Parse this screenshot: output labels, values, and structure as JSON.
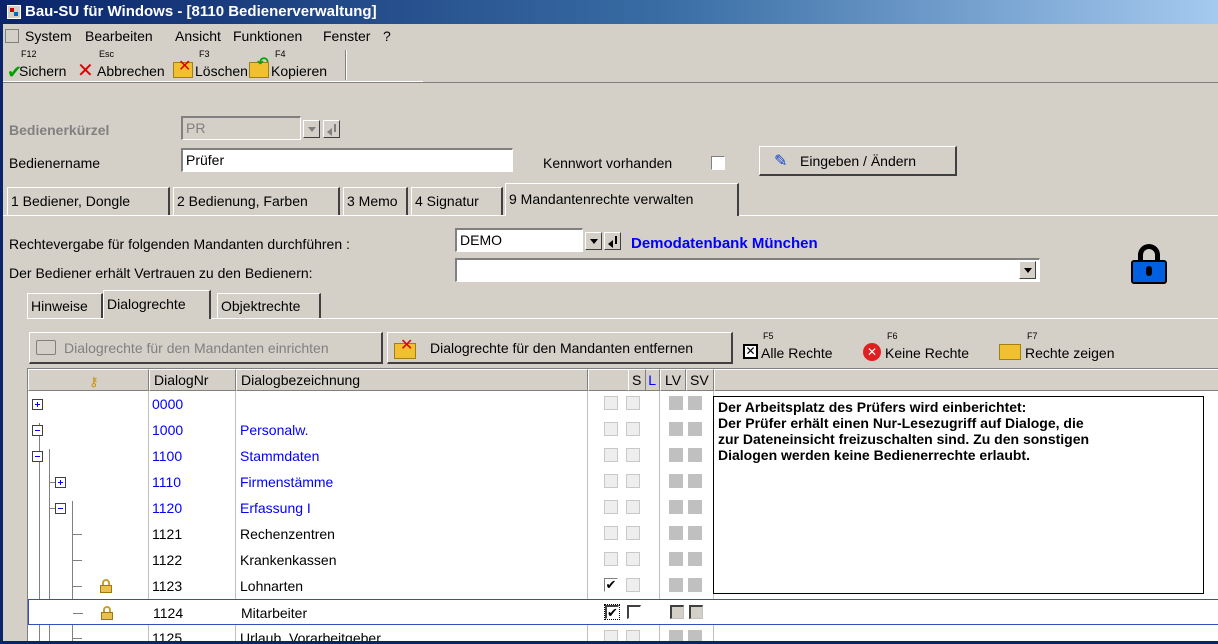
{
  "window": {
    "title": "Bau-SU für Windows - [8110 Bedienerverwaltung]"
  },
  "menu": [
    "System",
    "Bearbeiten",
    "Ansicht",
    "Funktionen",
    "Fenster",
    "?"
  ],
  "toolbar": {
    "save": {
      "key": "F12",
      "label": "Sichern"
    },
    "cancel": {
      "key": "Esc",
      "label": "Abbrechen"
    },
    "delete": {
      "key": "F3",
      "label": "Löschen"
    },
    "copy": {
      "key": "F4",
      "label": "Kopieren"
    }
  },
  "form": {
    "kuerzel_label": "Bedienerkürzel",
    "kuerzel_value": "PR",
    "name_label": "Bedienername",
    "name_value": "Prüfer",
    "kennwort_label": "Kennwort vorhanden",
    "kennwort_checked": false,
    "edit_button": "Eingeben / Ändern"
  },
  "tabs": [
    {
      "label": "1 Bediener, Dongle",
      "active": false
    },
    {
      "label": "2 Bedienung, Farben",
      "active": false
    },
    {
      "label": "3 Memo",
      "active": false
    },
    {
      "label": "4 Signatur",
      "active": false
    },
    {
      "label": "9 Mandantenrechte verwalten",
      "active": true
    }
  ],
  "mandant": {
    "label": "Rechtevergabe für folgenden Mandanten durchführen :",
    "value": "DEMO",
    "description": "Demodatenbank München",
    "vertrauen_label": "Der Bediener erhält Vertrauen zu den  Bedienern:",
    "vertrauen_value": ""
  },
  "subtabs": [
    {
      "label": "Hinweise",
      "active": false
    },
    {
      "label": "Dialogrechte",
      "active": true
    },
    {
      "label": "Objektrechte",
      "active": false
    }
  ],
  "actions": {
    "einrichten": "Dialogrechte für den Mandanten einrichten",
    "entfernen": "Dialogrechte für den Mandanten entfernen",
    "alle": {
      "key": "F5",
      "label": "Alle Rechte"
    },
    "keine": {
      "key": "F6",
      "label": "Keine Rechte"
    },
    "zeigen": {
      "key": "F7",
      "label": "Rechte zeigen"
    }
  },
  "grid": {
    "headers": {
      "nr": "DialogNr",
      "bez": "Dialogbezeichnung",
      "l": "L",
      "s": "S",
      "lv": "LV",
      "sv": "SV"
    },
    "rows": [
      {
        "nr": "0000",
        "bez": "",
        "blue": true,
        "l": false,
        "s": false
      },
      {
        "nr": "1000",
        "bez": "Personalw.",
        "blue": true,
        "l": false,
        "s": false
      },
      {
        "nr": "1100",
        "bez": "Stammdaten",
        "blue": true,
        "l": false,
        "s": false
      },
      {
        "nr": "1110",
        "bez": "Firmenstämme",
        "blue": true,
        "l": false,
        "s": false
      },
      {
        "nr": "1120",
        "bez": "Erfassung I",
        "blue": true,
        "l": false,
        "s": false
      },
      {
        "nr": "1121",
        "bez": "Rechenzentren",
        "blue": false,
        "l": false,
        "s": false
      },
      {
        "nr": "1122",
        "bez": "Krankenkassen",
        "blue": false,
        "l": false,
        "s": false
      },
      {
        "nr": "1123",
        "bez": "Lohnarten",
        "blue": false,
        "l": true,
        "s": false
      },
      {
        "nr": "1124",
        "bez": "Mitarbeiter",
        "blue": false,
        "l": true,
        "s": false
      },
      {
        "nr": "1125",
        "bez": "Urlaub, Vorarbeitgeber",
        "blue": false,
        "l": false,
        "s": false
      }
    ]
  },
  "note": {
    "lines": [
      "Der Arbeitsplatz des Prüfers wird einberichtet:",
      "Der Prüfer erhält einen Nur-Lesezugriff auf Dialoge, die",
      "zur Dateneinsicht freizuschalten sind. Zu den sonstigen",
      "Dialogen werden keine Bedienerrechte erlaubt."
    ]
  },
  "colors": {
    "accent": "#0a246a",
    "link": "#0000ff",
    "face": "#d4d0c8"
  }
}
